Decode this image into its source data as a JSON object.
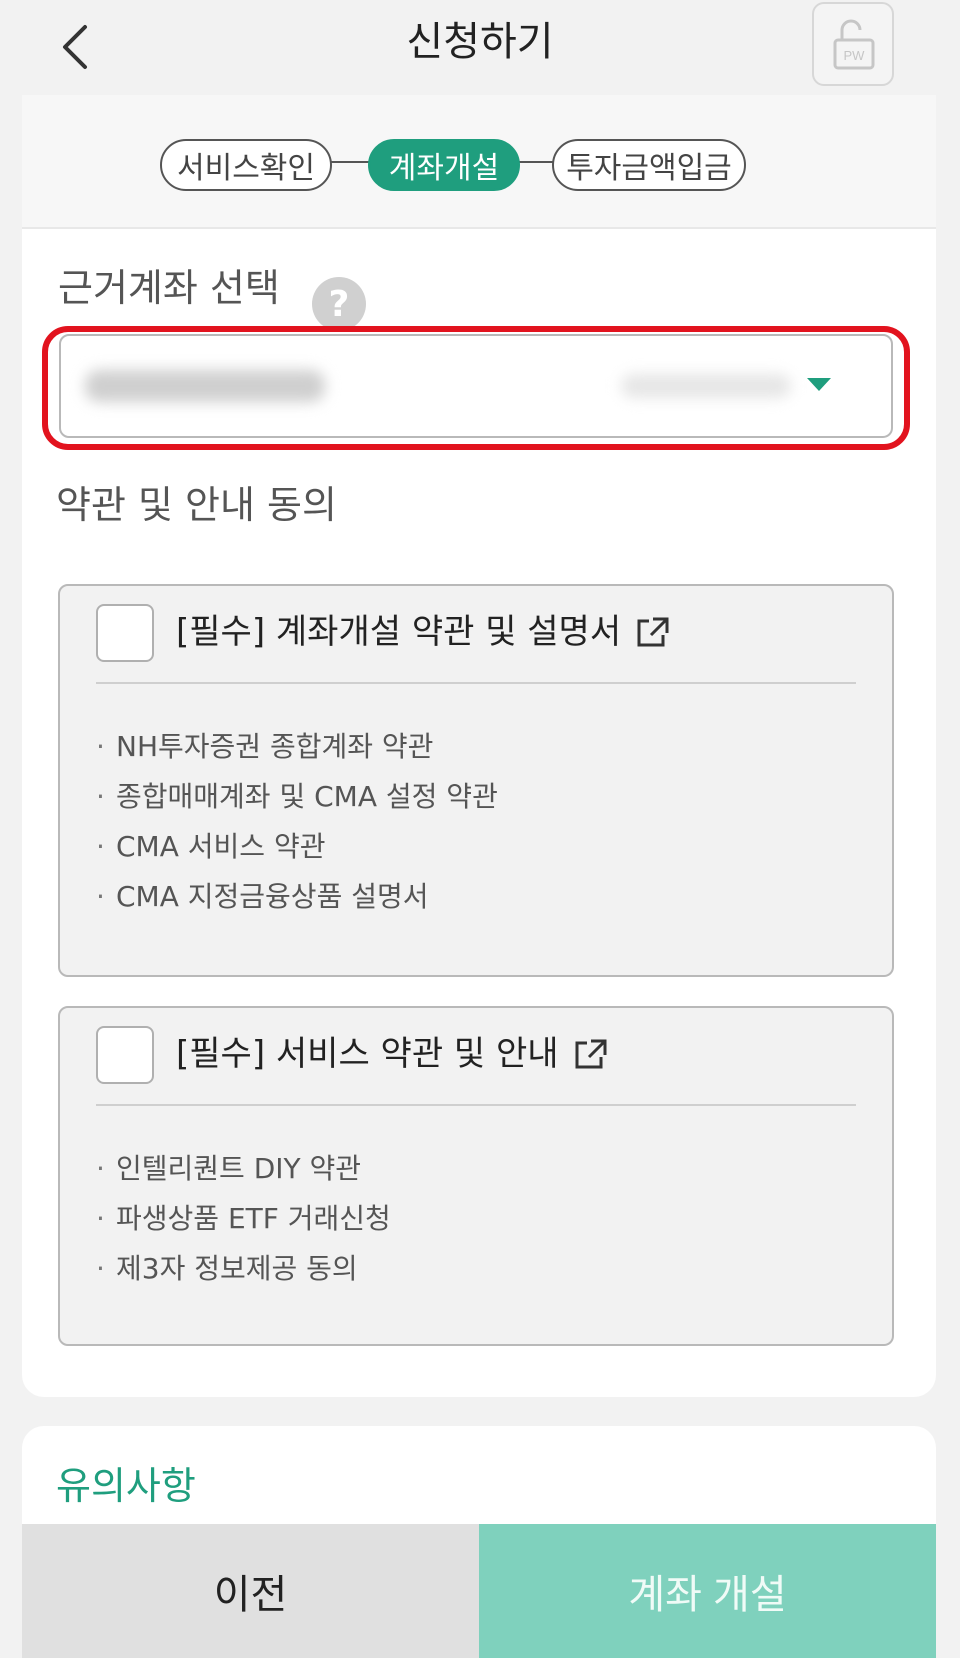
{
  "header": {
    "title": "신청하기",
    "pw_label": "PW"
  },
  "steps": [
    {
      "label": "서비스확인",
      "active": false
    },
    {
      "label": "계좌개설",
      "active": true
    },
    {
      "label": "투자금액입금",
      "active": false
    }
  ],
  "account_section": {
    "label": "근거계좌 선택",
    "help_symbol": "?"
  },
  "terms_section": {
    "label": "약관 및 안내 동의",
    "groups": [
      {
        "title": "[필수] 계좌개설 약관 및 설명서",
        "items": [
          "NH투자증권 종합계좌 약관",
          "종합매매계좌 및 CMA 설정 약관",
          "CMA 서비스 약관",
          "CMA 지정금융상품 설명서"
        ]
      },
      {
        "title": "[필수] 서비스 약관 및 안내",
        "items": [
          "인텔리퀀트 DIY 약관",
          "파생상품 ETF 거래신청",
          "제3자 정보제공 동의"
        ]
      }
    ]
  },
  "notice": {
    "title": "유의사항"
  },
  "footer": {
    "prev_label": "이전",
    "open_label": "계좌 개설"
  },
  "colors": {
    "accent": "#1f9e7e",
    "accent_light": "#7fd1bd",
    "highlight": "#e2131e"
  }
}
